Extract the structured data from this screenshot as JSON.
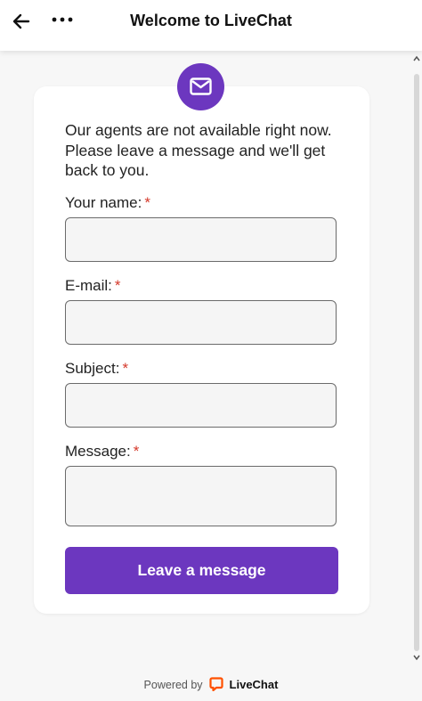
{
  "header": {
    "title": "Welcome to LiveChat",
    "back_icon": "arrow-left-icon",
    "menu_icon": "more-dots-icon"
  },
  "card": {
    "badge_icon": "envelope-icon",
    "intro": "Our agents are not available right now. Please leave a message and we'll get back to you.",
    "required_marker": "*",
    "fields": {
      "name": {
        "label": "Your name:",
        "value": ""
      },
      "email": {
        "label": "E-mail:",
        "value": ""
      },
      "subject": {
        "label": "Subject:",
        "value": ""
      },
      "message": {
        "label": "Message:",
        "value": ""
      }
    },
    "submit_label": "Leave a message"
  },
  "footer": {
    "powered_by": "Powered by",
    "brand": "LiveChat",
    "brand_icon": "livechat-logo-icon"
  },
  "colors": {
    "accent": "#6c37bf",
    "required": "#d5392b",
    "brand_orange": "#ff5100"
  }
}
